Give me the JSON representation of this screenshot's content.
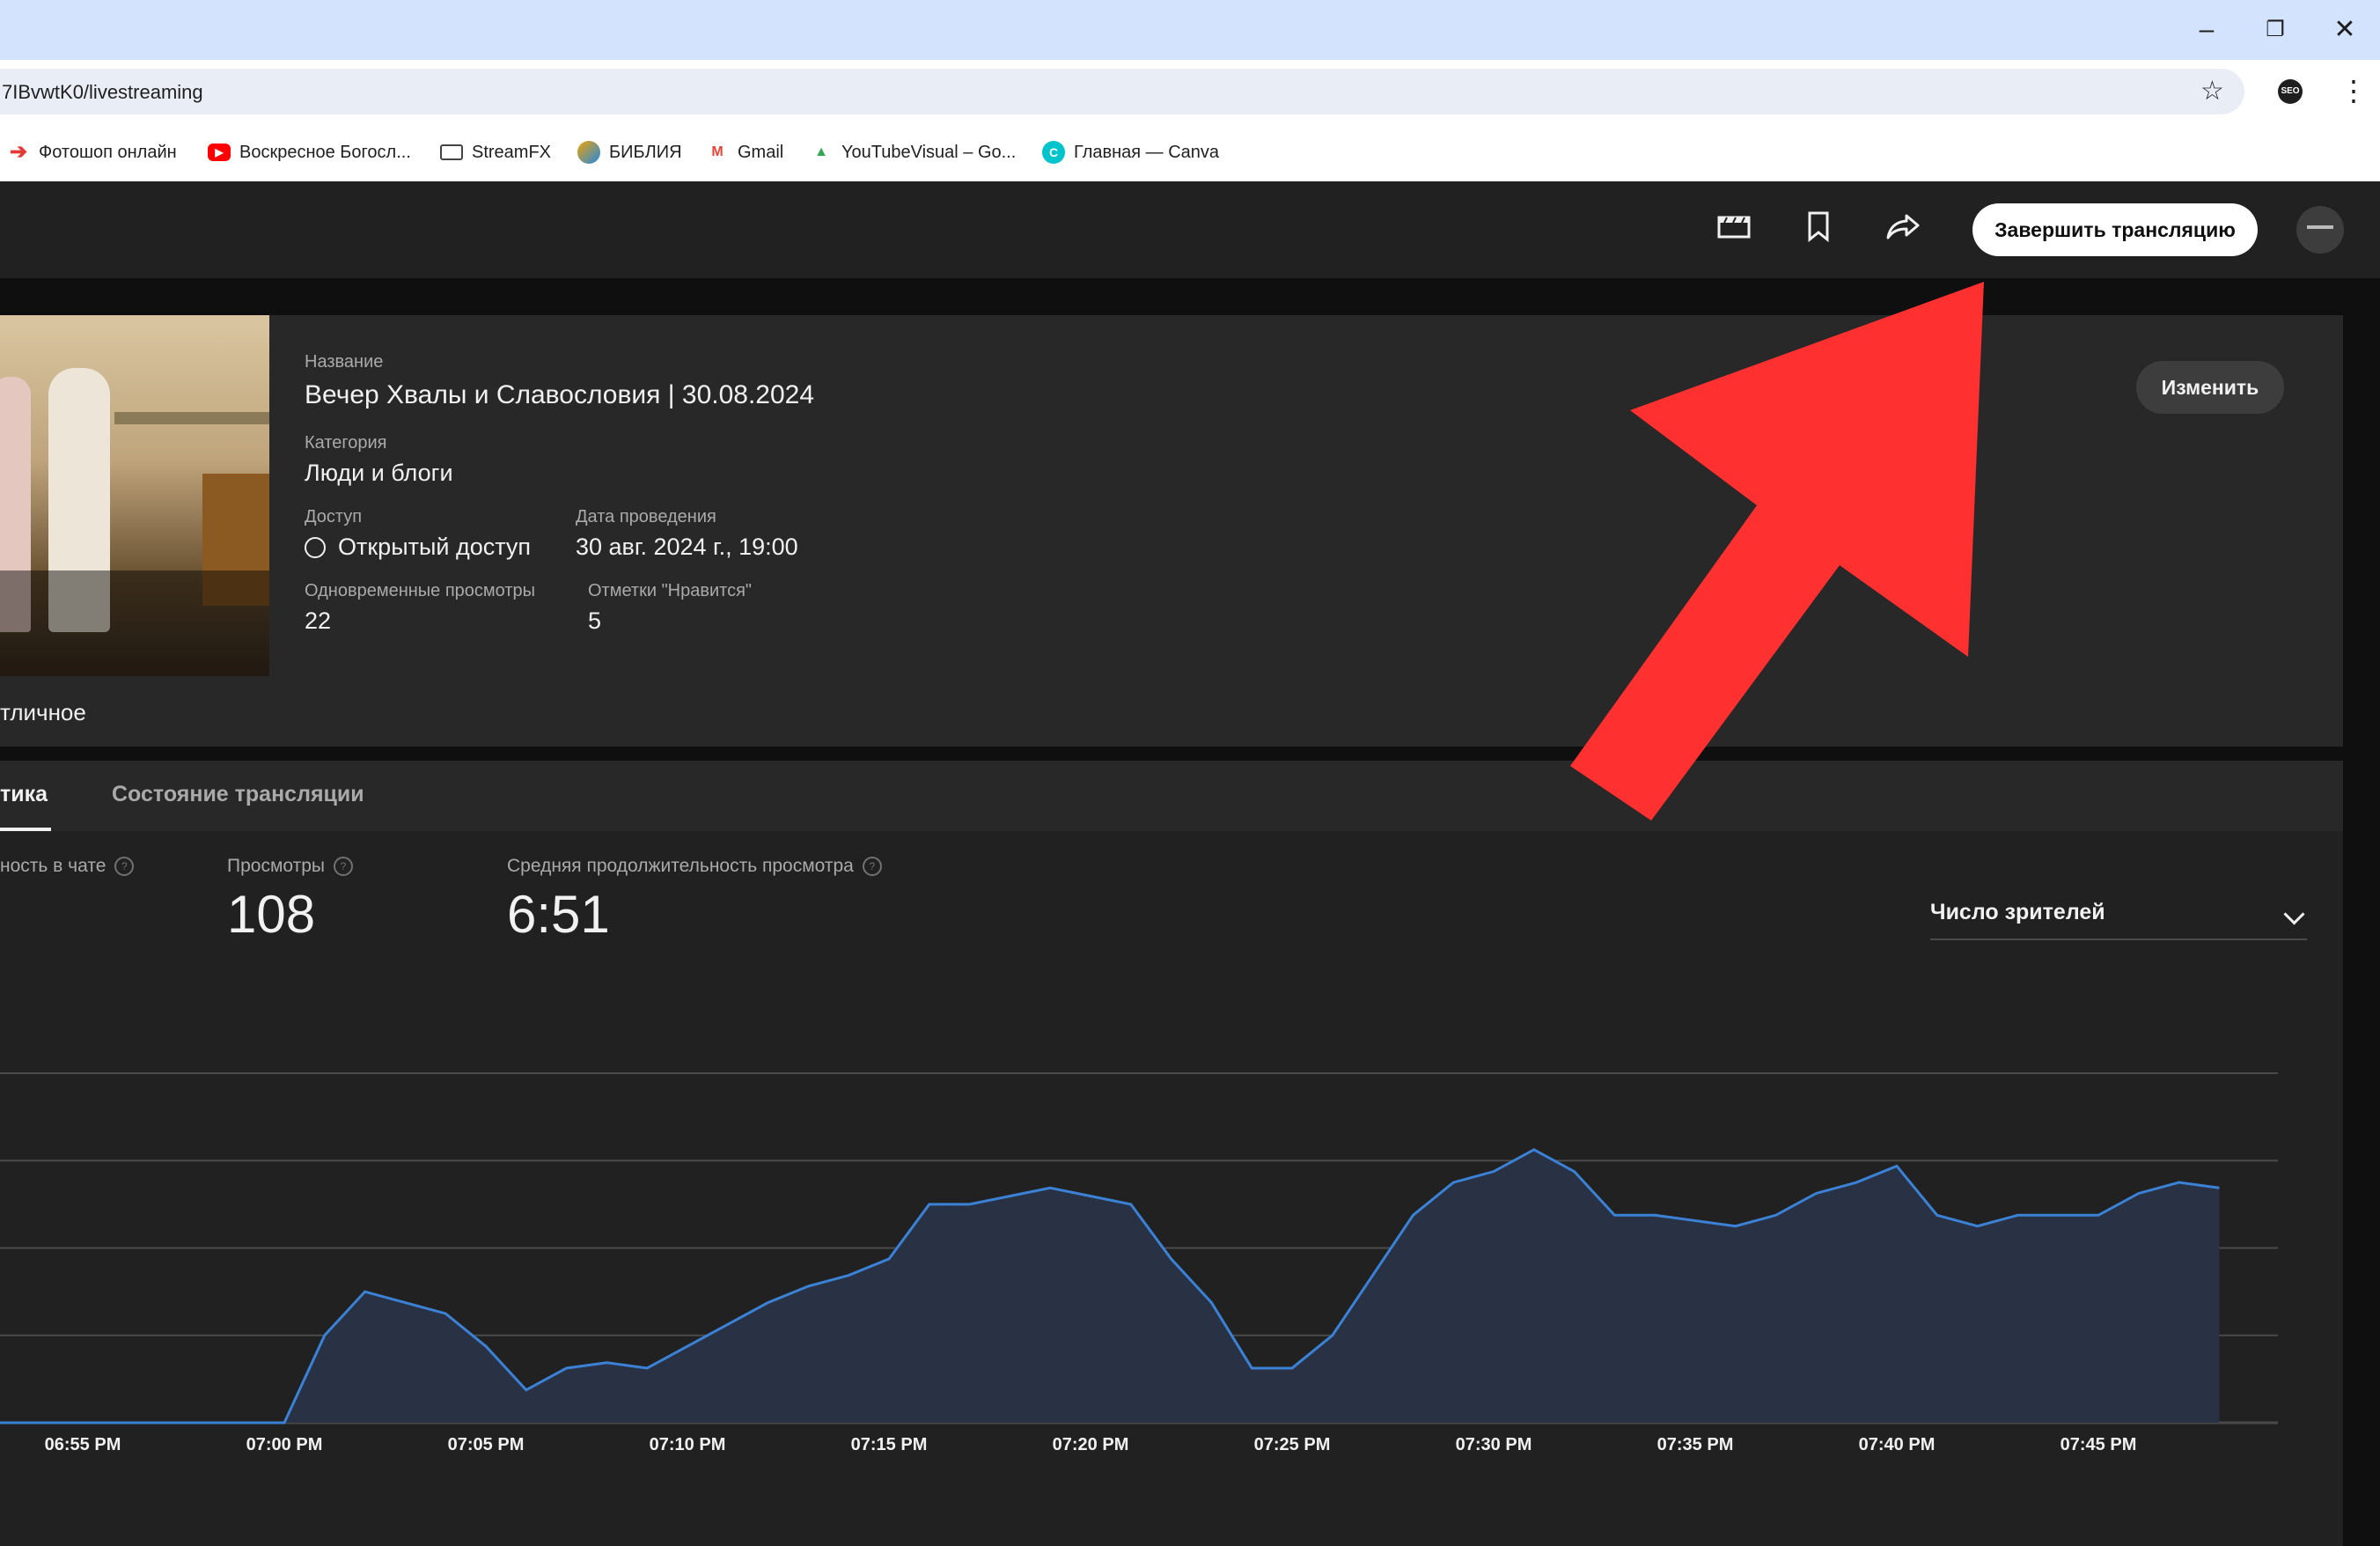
{
  "browser": {
    "url": "7IBvwtK0/livestreaming",
    "bookmarks": [
      {
        "label": "Фотошоп онлайн",
        "icon": "photoshop-arrow-icon",
        "color": "#e53935"
      },
      {
        "label": "Воскресное Богосл...",
        "icon": "youtube-icon",
        "color": "#ff0000"
      },
      {
        "label": "StreamFX",
        "icon": "folder-icon",
        "color": "#444444"
      },
      {
        "label": "БИБЛИЯ",
        "icon": "bible-app-icon",
        "color": "#f4a300"
      },
      {
        "label": "Gmail",
        "icon": "gmail-icon",
        "color": "#ea4335"
      },
      {
        "label": "YouTubeVisual – Go...",
        "icon": "google-drive-icon",
        "color": "#34a853"
      },
      {
        "label": "Главная — Canva",
        "icon": "canva-icon",
        "color": "#00c4cc"
      }
    ]
  },
  "header": {
    "end_stream_label": "Завершить трансляцию",
    "icons": [
      "clapperboard-icon",
      "bookmark-icon",
      "share-icon"
    ]
  },
  "info": {
    "title_label": "Название",
    "title": "Вечер Хвалы и Славословия | 30.08.2024",
    "category_label": "Категория",
    "category": "Люди и блоги",
    "access_label": "Доступ",
    "access": "Открытый доступ",
    "date_label": "Дата проведения",
    "date": "30 авг. 2024 г., 19:00",
    "concurrent_label": "Одновременные просмотры",
    "concurrent": "22",
    "likes_label": "Отметки \"Нравится\"",
    "likes": "5",
    "edit_label": "Изменить",
    "quality": "тличное"
  },
  "tabs": [
    {
      "label": "тика",
      "active": true
    },
    {
      "label": "Состояние трансляции",
      "active": false
    }
  ],
  "stats": [
    {
      "label": "ность в чате",
      "value": ""
    },
    {
      "label": "Просмотры",
      "value": "108"
    },
    {
      "label": "Средняя продолжительность просмотра",
      "value": "6:51"
    }
  ],
  "metric_select": "Число зрителей",
  "chart_data": {
    "type": "area",
    "x_ticks": [
      "06:55 PM",
      "07:00 PM",
      "07:05 PM",
      "07:10 PM",
      "07:15 PM",
      "07:20 PM",
      "07:25 PM",
      "07:30 PM",
      "07:35 PM",
      "07:40 PM",
      "07:45 PM"
    ],
    "series": [
      {
        "x": [
          6.55,
          7.0,
          7.01,
          7.02,
          7.04,
          7.05,
          7.06,
          7.07,
          7.08,
          7.09,
          7.11,
          7.12,
          7.13,
          7.14,
          7.15,
          7.16,
          7.17,
          7.19,
          7.21,
          7.22,
          7.23,
          7.24,
          7.25,
          7.26,
          7.28,
          7.29,
          7.3,
          7.31,
          7.32,
          7.33,
          7.34,
          7.36,
          7.37,
          7.38,
          7.39,
          7.4,
          7.41,
          7.42,
          7.43,
          7.45,
          7.46,
          7.47,
          7.48
        ],
        "values": [
          0,
          0,
          8,
          12,
          10,
          7,
          3,
          5,
          5.5,
          5,
          9,
          11,
          12.5,
          13.5,
          15,
          20,
          20,
          21.5,
          20,
          15,
          11,
          5,
          5,
          8,
          19,
          22,
          23,
          25,
          23,
          19,
          19,
          18,
          19,
          21,
          22,
          23.5,
          19,
          18,
          19,
          19,
          21,
          22,
          21.5
        ]
      }
    ],
    "y_gridlines": 4,
    "ylim": [
      0,
      32
    ],
    "grid": true,
    "colors": {
      "line": "#3b82d6",
      "fill": "#283244",
      "grid": "#4a4a4a"
    }
  },
  "annotation": {
    "arrow_color": "#ff3030",
    "arrow_shape": "red-arrow-pointing-to-end-stream-button"
  }
}
